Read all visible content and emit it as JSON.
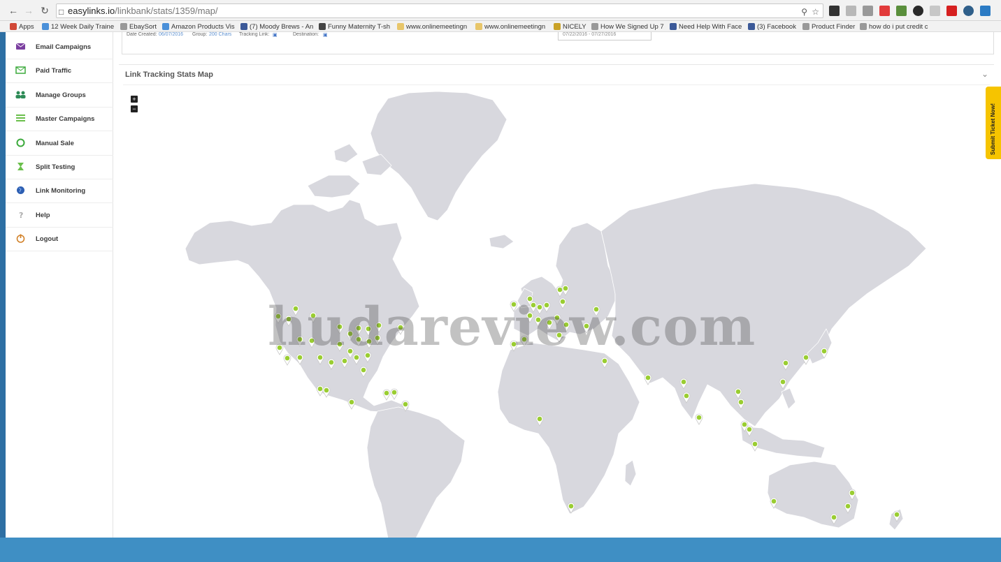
{
  "browser": {
    "url_domain": "easylinks.io",
    "url_path": "/linkbank/stats/1359/map/",
    "bookmarks": [
      {
        "label": "Apps",
        "icon": "apps-icon",
        "color": "#d14836"
      },
      {
        "label": "12 Week Daily Traine",
        "icon": "bookmark-icon",
        "color": "#4a90d9"
      },
      {
        "label": "EbaySort",
        "icon": "page-icon",
        "color": "#999999"
      },
      {
        "label": "Amazon Products Vis",
        "icon": "bookmark-icon",
        "color": "#4a90d9"
      },
      {
        "label": "(7) Moody Brews - An",
        "icon": "facebook-icon",
        "color": "#3b5998"
      },
      {
        "label": "Funny Maternity T-sh",
        "icon": "bookmark-icon",
        "color": "#444444"
      },
      {
        "label": "www.onlinemeetingn",
        "icon": "folder-icon",
        "color": "#e8c66a"
      },
      {
        "label": "www.onlinemeetingn",
        "icon": "folder-icon",
        "color": "#e8c66a"
      },
      {
        "label": "NICELY",
        "icon": "bookmark-icon",
        "color": "#c9a227"
      },
      {
        "label": "How We Signed Up 7",
        "icon": "page-icon",
        "color": "#999999"
      },
      {
        "label": "Need Help With Face",
        "icon": "bookmark-icon",
        "color": "#3b5998"
      },
      {
        "label": "(3) Facebook",
        "icon": "facebook-icon",
        "color": "#3b5998"
      },
      {
        "label": "Product Finder",
        "icon": "page-icon",
        "color": "#999999"
      },
      {
        "label": "how do i put credit c",
        "icon": "page-icon",
        "color": "#999999"
      }
    ]
  },
  "sidebar": {
    "items": [
      {
        "label": "Email Campaigns",
        "icon": "envelope-icon",
        "color": "#7b3fa0"
      },
      {
        "label": "Paid Traffic",
        "icon": "envelope-open-icon",
        "color": "#3caa3c"
      },
      {
        "label": "Manage Groups",
        "icon": "users-icon",
        "color": "#2e8b57"
      },
      {
        "label": "Master Campaigns",
        "icon": "list-icon",
        "color": "#6abf4b"
      },
      {
        "label": "Manual Sale",
        "icon": "refresh-icon",
        "color": "#3caa3c"
      },
      {
        "label": "Split Testing",
        "icon": "hourglass-icon",
        "color": "#6abf4b"
      },
      {
        "label": "Link Monitoring",
        "icon": "globe-icon",
        "color": "#2d5fb3"
      },
      {
        "label": "Help",
        "icon": "help-icon",
        "color": "#aaaaaa"
      },
      {
        "label": "Logout",
        "icon": "power-icon",
        "color": "#d2822a"
      }
    ]
  },
  "summary": {
    "date_created_label": "Date Created:",
    "date_created_value": "06/07/2016",
    "group_label": "Group:",
    "group_value": "200 Chars",
    "tracking_link_label": "Tracking Link:",
    "destination_label": "Destination:",
    "date_range": "07/22/2016 - 07/27/2016"
  },
  "map_panel": {
    "title": "Link Tracking Stats Map",
    "zoom_in": "+",
    "zoom_out": "−"
  },
  "watermark": "hudareview.com",
  "support_tab": "Submit Ticket Now!",
  "colors": {
    "land": "#d8d8de",
    "marker": "#9acd32",
    "accent": "#2d6fa3",
    "taskbar": "#3f8fc4"
  }
}
